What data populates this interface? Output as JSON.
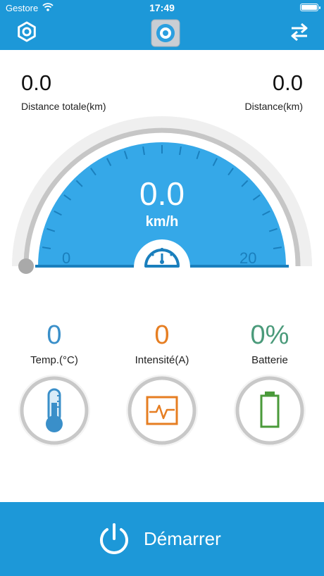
{
  "status_bar": {
    "carrier": "Gestore",
    "time": "17:49"
  },
  "header": {
    "settings_icon": "gear-icon",
    "logo_icon": "app-logo",
    "swap_icon": "swap-arrows-icon",
    "color": "#1d98d8"
  },
  "stats": {
    "total_distance": {
      "value": "0.0",
      "label": "Distance totale(km)"
    },
    "trip_distance": {
      "value": "0.0",
      "label": "Distance(km)"
    }
  },
  "speedometer": {
    "speed": "0.0",
    "unit": "km/h",
    "scale_min": "0",
    "scale_max": "20",
    "level": 0,
    "icon": "speedometer-icon",
    "color": "#35a8e8"
  },
  "metrics": [
    {
      "value": "0",
      "label": "Temp.(°C)",
      "icon": "thermometer-icon",
      "color": "#3a8fc9"
    },
    {
      "value": "0",
      "label": "Intensité(A)",
      "icon": "waveform-icon",
      "color": "#e67e22"
    },
    {
      "value": "0%",
      "label": "Batterie",
      "icon": "battery-icon",
      "color": "#4a9a7a"
    }
  ],
  "start_button": {
    "label": "Démarrer",
    "icon": "power-icon"
  }
}
